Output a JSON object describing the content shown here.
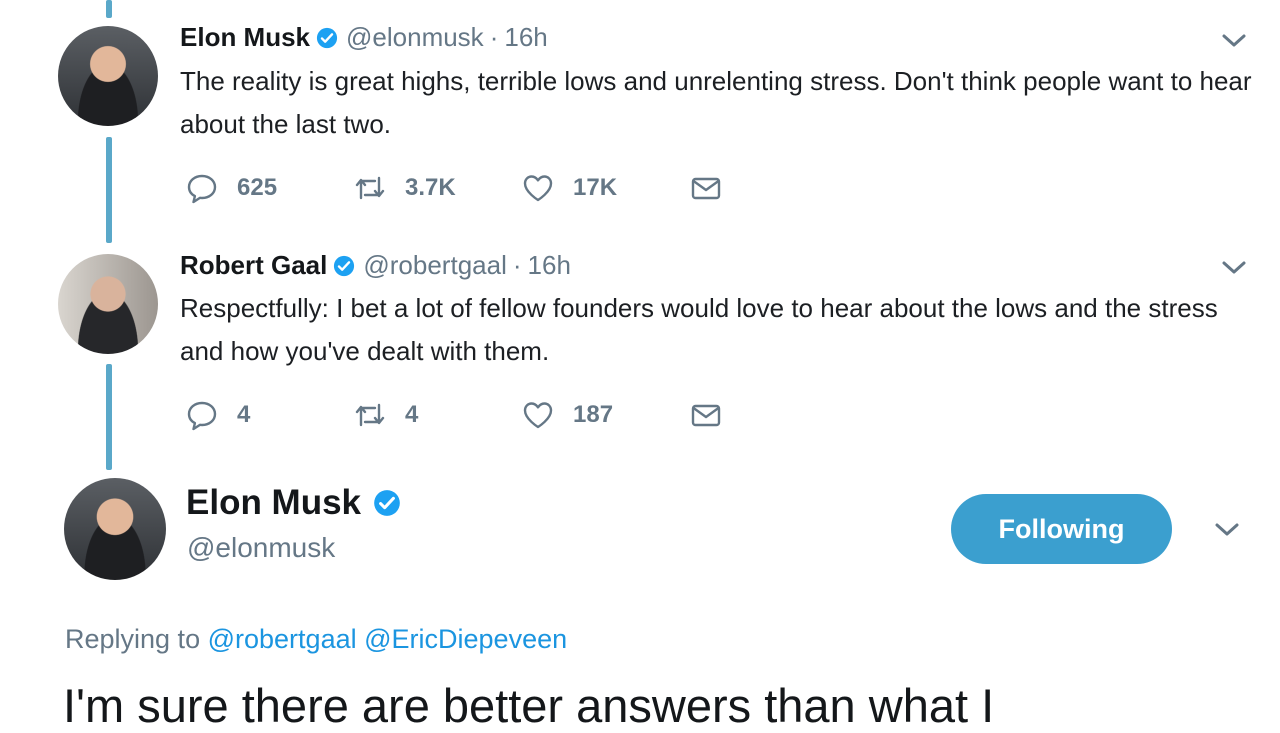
{
  "tweets": [
    {
      "name": "Elon Musk",
      "handle": "@elonmusk",
      "separator": "·",
      "time": "16h",
      "text": "The reality is great highs, terrible lows and unrelenting stress. Don't think people want to hear about the last two.",
      "replies": "625",
      "retweets": "3.7K",
      "likes": "17K"
    },
    {
      "name": "Robert Gaal",
      "handle": "@robertgaal",
      "separator": "·",
      "time": "16h",
      "text": "Respectfully: I bet a lot of fellow founders would love to hear about the lows and the stress and how you've dealt with them.",
      "replies": "4",
      "retweets": "4",
      "likes": "187"
    }
  ],
  "main_tweet": {
    "name": "Elon Musk",
    "handle": "@elonmusk",
    "follow_label": "Following",
    "replying_prefix": "Replying to",
    "replying_to": [
      "@robertgaal",
      "@EricDiepeveen"
    ],
    "text": "I'm sure there are better answers than what I"
  },
  "icons": {
    "verified": "verified-badge-icon",
    "reply": "reply-icon",
    "retweet": "retweet-icon",
    "like": "heart-icon",
    "dm": "envelope-icon",
    "menu": "chevron-down-icon"
  },
  "colors": {
    "accent": "#1da1f2",
    "button": "#3b9fcf",
    "thread_line": "#5aa8c9",
    "secondary_text": "#657786"
  }
}
